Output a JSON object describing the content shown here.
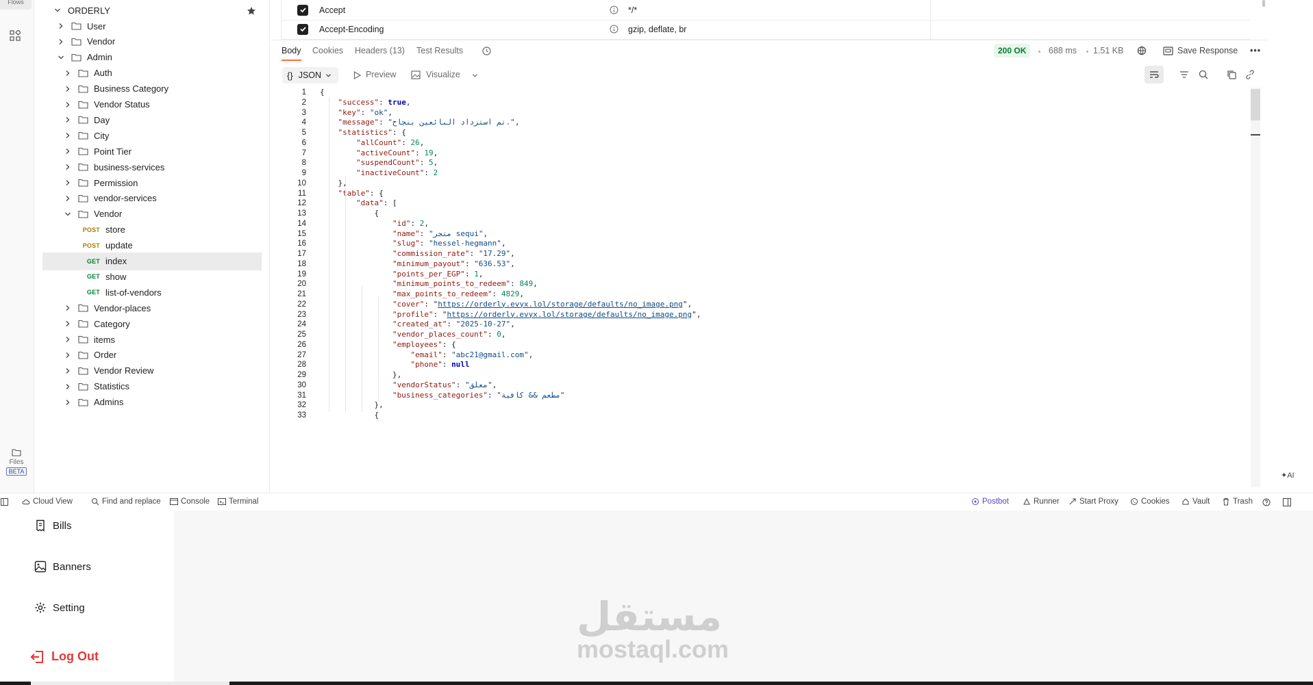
{
  "rail": {
    "flows_label": "Flows",
    "files_label": "Files",
    "beta_label": "BETA"
  },
  "collection": {
    "name": "ORDERLY",
    "tree": [
      {
        "depth": 1,
        "type": "folder",
        "label": "User",
        "state": "collapsed"
      },
      {
        "depth": 1,
        "type": "folder",
        "label": "Vendor",
        "state": "collapsed"
      },
      {
        "depth": 1,
        "type": "folder",
        "label": "Admin",
        "state": "expanded"
      },
      {
        "depth": 2,
        "type": "folder",
        "label": "Auth",
        "state": "collapsed"
      },
      {
        "depth": 2,
        "type": "folder",
        "label": "Business Category",
        "state": "collapsed"
      },
      {
        "depth": 2,
        "type": "folder",
        "label": "Vendor Status",
        "state": "collapsed"
      },
      {
        "depth": 2,
        "type": "folder",
        "label": "Day",
        "state": "collapsed"
      },
      {
        "depth": 2,
        "type": "folder",
        "label": "City",
        "state": "collapsed"
      },
      {
        "depth": 2,
        "type": "folder",
        "label": "Point Tier",
        "state": "collapsed"
      },
      {
        "depth": 2,
        "type": "folder",
        "label": "business-services",
        "state": "collapsed"
      },
      {
        "depth": 2,
        "type": "folder",
        "label": "Permission",
        "state": "collapsed"
      },
      {
        "depth": 2,
        "type": "folder",
        "label": "vendor-services",
        "state": "collapsed"
      },
      {
        "depth": 2,
        "type": "folder",
        "label": "Vendor",
        "state": "expanded"
      },
      {
        "depth": 3,
        "type": "request",
        "method": "POST",
        "label": "store"
      },
      {
        "depth": 3,
        "type": "request",
        "method": "POST",
        "label": "update"
      },
      {
        "depth": 3,
        "type": "request",
        "method": "GET",
        "label": "index",
        "selected": true
      },
      {
        "depth": 3,
        "type": "request",
        "method": "GET",
        "label": "show"
      },
      {
        "depth": 3,
        "type": "request",
        "method": "GET",
        "label": "list-of-vendors"
      },
      {
        "depth": 2,
        "type": "folder",
        "label": "Vendor-places",
        "state": "collapsed"
      },
      {
        "depth": 2,
        "type": "folder",
        "label": "Category",
        "state": "collapsed"
      },
      {
        "depth": 2,
        "type": "folder",
        "label": "items",
        "state": "collapsed"
      },
      {
        "depth": 2,
        "type": "folder",
        "label": "Order",
        "state": "collapsed"
      },
      {
        "depth": 2,
        "type": "folder",
        "label": "Vendor Review",
        "state": "collapsed"
      },
      {
        "depth": 2,
        "type": "folder",
        "label": "Statistics",
        "state": "collapsed"
      },
      {
        "depth": 2,
        "type": "folder",
        "label": "Admins",
        "state": "collapsed"
      }
    ]
  },
  "request_headers": [
    {
      "key": "Accept",
      "value": "*/*",
      "checked": true
    },
    {
      "key": "Accept-Encoding",
      "value": "gzip, deflate, br",
      "checked": true
    }
  ],
  "response": {
    "tabs": [
      "Body",
      "Cookies",
      "Headers (13)",
      "Test Results"
    ],
    "active_tab": "Body",
    "status": "200 OK",
    "time": "688 ms",
    "size": "1.51 KB",
    "save_label": "Save Response",
    "format": "JSON",
    "preview_label": "Preview",
    "visualize_label": "Visualize"
  },
  "body_lines": [
    "{",
    "    \"success\": true,",
    "    \"key\": \"ok\",",
    "    \"message\": \"تم استرداد البائعين بنجاح.\",",
    "    \"statistics\": {",
    "        \"allCount\": 26,",
    "        \"activeCount\": 19,",
    "        \"suspendCount\": 5,",
    "        \"inactiveCount\": 2",
    "    },",
    "    \"table\": {",
    "        \"data\": [",
    "            {",
    "                \"id\": 2,",
    "                \"name\": \"متجر sequi\",",
    "                \"slug\": \"hessel-hegmann\",",
    "                \"commission_rate\": \"17.29\",",
    "                \"minimum_payout\": \"636.53\",",
    "                \"points_per_EGP\": 1,",
    "                \"minimum_points_to_redeem\": 849,",
    "                \"max_points_to_redeem\": 4829,",
    "                \"cover\": \"https://orderly.evyx.lol/storage/defaults/no_image.png\",",
    "                \"profile\": \"https://orderly.evyx.lol/storage/defaults/no_image.png\",",
    "                \"created_at\": \"2025-10-27\",",
    "                \"vendor_places_count\": 0,",
    "                \"employees\": {",
    "                    \"email\": \"abc21@gmail.com\",",
    "                    \"phone\": null",
    "                },",
    "                \"vendorStatus\": \"معلق\",",
    "                \"business_categories\": \"مطعم && كافية\"",
    "            },",
    "            {"
  ],
  "statusbar": {
    "left": [
      "Cloud View",
      "Find and replace",
      "Console",
      "Terminal"
    ],
    "right": [
      "Postbot",
      "Runner",
      "Start Proxy",
      "Cookies",
      "Vault",
      "Trash"
    ]
  },
  "app_menu": [
    {
      "label": "Bills",
      "icon": "bill-icon"
    },
    {
      "label": "Banners",
      "icon": "image-icon"
    },
    {
      "label": "Setting",
      "icon": "gear-icon"
    }
  ],
  "logout_label": "Log Out",
  "watermark": {
    "arabic": "مستقل",
    "latin": "mostaql.com"
  },
  "colors": {
    "accent": "#ff6c37",
    "get": "#007f31",
    "post": "#ad7a03",
    "status_ok": "#007f31",
    "logout": "#e53935"
  }
}
